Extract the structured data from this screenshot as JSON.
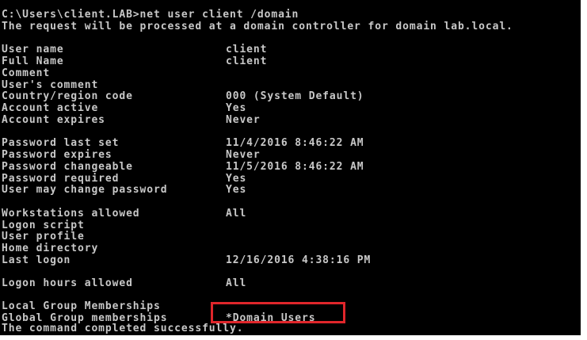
{
  "terminal": {
    "command_prompt": "C:\\Users\\client.LAB>net user client /domain",
    "request_message": "The request will be processed at a domain controller for domain lab.local.",
    "fields": [
      {
        "label": "User name",
        "value": "client"
      },
      {
        "label": "Full Name",
        "value": "client"
      },
      {
        "label": "Comment",
        "value": ""
      },
      {
        "label": "User's comment",
        "value": ""
      },
      {
        "label": "Country/region code",
        "value": "000 (System Default)"
      },
      {
        "label": "Account active",
        "value": "Yes"
      },
      {
        "label": "Account expires",
        "value": "Never"
      },
      {
        "label": "Password last set",
        "value": "11/4/2016 8:46:22 AM"
      },
      {
        "label": "Password expires",
        "value": "Never"
      },
      {
        "label": "Password changeable",
        "value": "11/5/2016 8:46:22 AM"
      },
      {
        "label": "Password required",
        "value": "Yes"
      },
      {
        "label": "User may change password",
        "value": "Yes"
      },
      {
        "label": "Workstations allowed",
        "value": "All"
      },
      {
        "label": "Logon script",
        "value": ""
      },
      {
        "label": "User profile",
        "value": ""
      },
      {
        "label": "Home directory",
        "value": ""
      },
      {
        "label": "Last logon",
        "value": "12/16/2016 4:38:16 PM"
      },
      {
        "label": "Logon hours allowed",
        "value": "All"
      },
      {
        "label": "Local Group Memberships",
        "value": ""
      },
      {
        "label": "Global Group memberships",
        "value": "*Domain Users"
      }
    ],
    "completion_message": "The command completed successfully."
  },
  "colors": {
    "background": "#000000",
    "text": "#c8c8c8",
    "highlight_border": "#e0262b"
  }
}
